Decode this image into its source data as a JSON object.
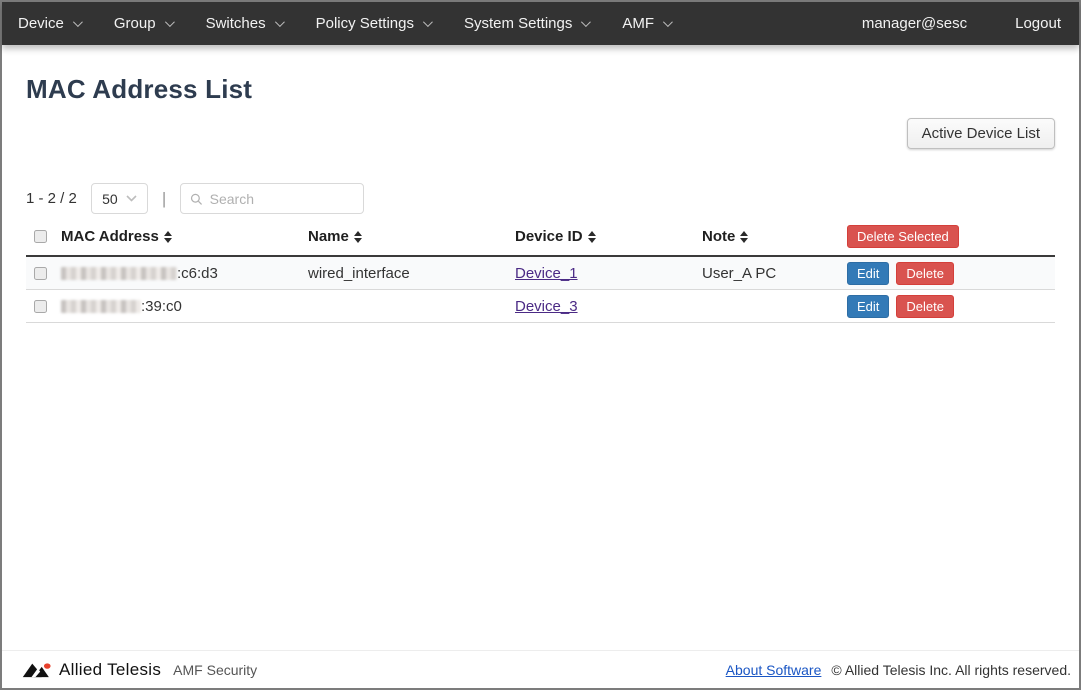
{
  "navbar": {
    "items": [
      {
        "label": "Device"
      },
      {
        "label": "Group"
      },
      {
        "label": "Switches"
      },
      {
        "label": "Policy Settings"
      },
      {
        "label": "System Settings"
      },
      {
        "label": "AMF"
      }
    ],
    "user": "manager@sesc",
    "logout_label": "Logout"
  },
  "page": {
    "title": "MAC Address List",
    "active_device_list_button": "Active Device List"
  },
  "toolbar": {
    "range_text": "1 - 2 / 2",
    "page_size": "50",
    "separator": "|",
    "search_placeholder": "Search"
  },
  "table": {
    "columns": {
      "mac": "MAC Address",
      "name": "Name",
      "device_id": "Device ID",
      "note": "Note"
    },
    "delete_selected_label": "Delete Selected",
    "edit_label": "Edit",
    "delete_label": "Delete",
    "rows": [
      {
        "mac_redacted_prefix": true,
        "mac_visible": ":c6:d3",
        "name": "wired_interface",
        "device_id": "Device_1",
        "note": "User_A PC"
      },
      {
        "mac_redacted_prefix": true,
        "mac_visible": ":39:c0",
        "name": "",
        "device_id": "Device_3",
        "note": ""
      }
    ]
  },
  "footer": {
    "brand": "Allied Telesis",
    "product": "AMF Security",
    "about_link": "About Software",
    "copyright": "© Allied Telesis Inc. All rights reserved."
  },
  "icons": {
    "chevron-down-icon": "nav dropdown caret",
    "search-icon": "magnifier glyph in search box",
    "sort-icon": "stacked up/down triangles on sortable columns",
    "allied-telesis-logo": "black twin-peak mark with red dot"
  },
  "colors": {
    "navbar_bg": "#333333",
    "title_text": "#2e3c4f",
    "primary_button": "#337ab7",
    "danger_button": "#d9534f",
    "visited_link": "#4b2a85",
    "footer_link": "#1a56c4"
  }
}
